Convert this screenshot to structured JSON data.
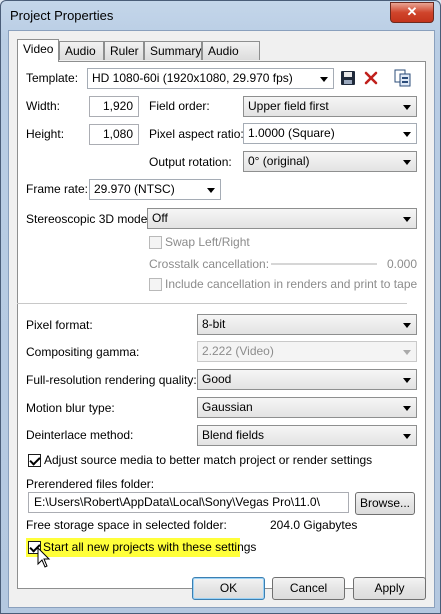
{
  "window": {
    "title": "Project Properties",
    "close_glyph": "✕"
  },
  "tabs": [
    "Video",
    "Audio",
    "Ruler",
    "Summary",
    "Audio CD"
  ],
  "template": {
    "label": "Template:",
    "value": "HD 1080-60i (1920x1080, 29.970 fps)",
    "icons": [
      "save-icon",
      "delete-icon",
      "match-media-icon"
    ]
  },
  "width": {
    "label": "Width:",
    "value": "1,920"
  },
  "height": {
    "label": "Height:",
    "value": "1,080"
  },
  "field_order": {
    "label": "Field order:",
    "value": "Upper field first"
  },
  "pixel_aspect": {
    "label": "Pixel aspect ratio:",
    "value": "1.0000 (Square)"
  },
  "output_rotation": {
    "label": "Output rotation:",
    "value": "0° (original)"
  },
  "frame_rate": {
    "label": "Frame rate:",
    "value": "29.970 (NTSC)"
  },
  "stereo": {
    "label": "Stereoscopic 3D mode:",
    "value": "Off",
    "swap_label": "Swap Left/Right",
    "crosstalk_label": "Crosstalk cancellation:",
    "crosstalk_value": "0.000",
    "include_label": "Include cancellation in renders and print to tape"
  },
  "pixel_format": {
    "label": "Pixel format:",
    "value": "8-bit"
  },
  "compositing_gamma": {
    "label": "Compositing gamma:",
    "value": "2.222 (Video)"
  },
  "render_quality": {
    "label": "Full-resolution rendering quality:",
    "value": "Good"
  },
  "motion_blur": {
    "label": "Motion blur type:",
    "value": "Gaussian"
  },
  "deinterlace": {
    "label": "Deinterlace method:",
    "value": "Blend fields"
  },
  "adjust_source": {
    "label": "Adjust source media to better match project or render settings",
    "checked": true
  },
  "prerendered": {
    "label": "Prerendered files folder:",
    "value": "E:\\Users\\Robert\\AppData\\Local\\Sony\\Vegas Pro\\11.0\\",
    "browse_label": "Browse..."
  },
  "free_space": {
    "label": "Free storage space in selected folder:",
    "value": "204.0 Gigabytes"
  },
  "start_all": {
    "label": "Start all new projects with these settings",
    "checked": true,
    "highlight_color": "#ffff3a"
  },
  "buttons": {
    "ok": "OK",
    "cancel": "Cancel",
    "apply": "Apply"
  }
}
